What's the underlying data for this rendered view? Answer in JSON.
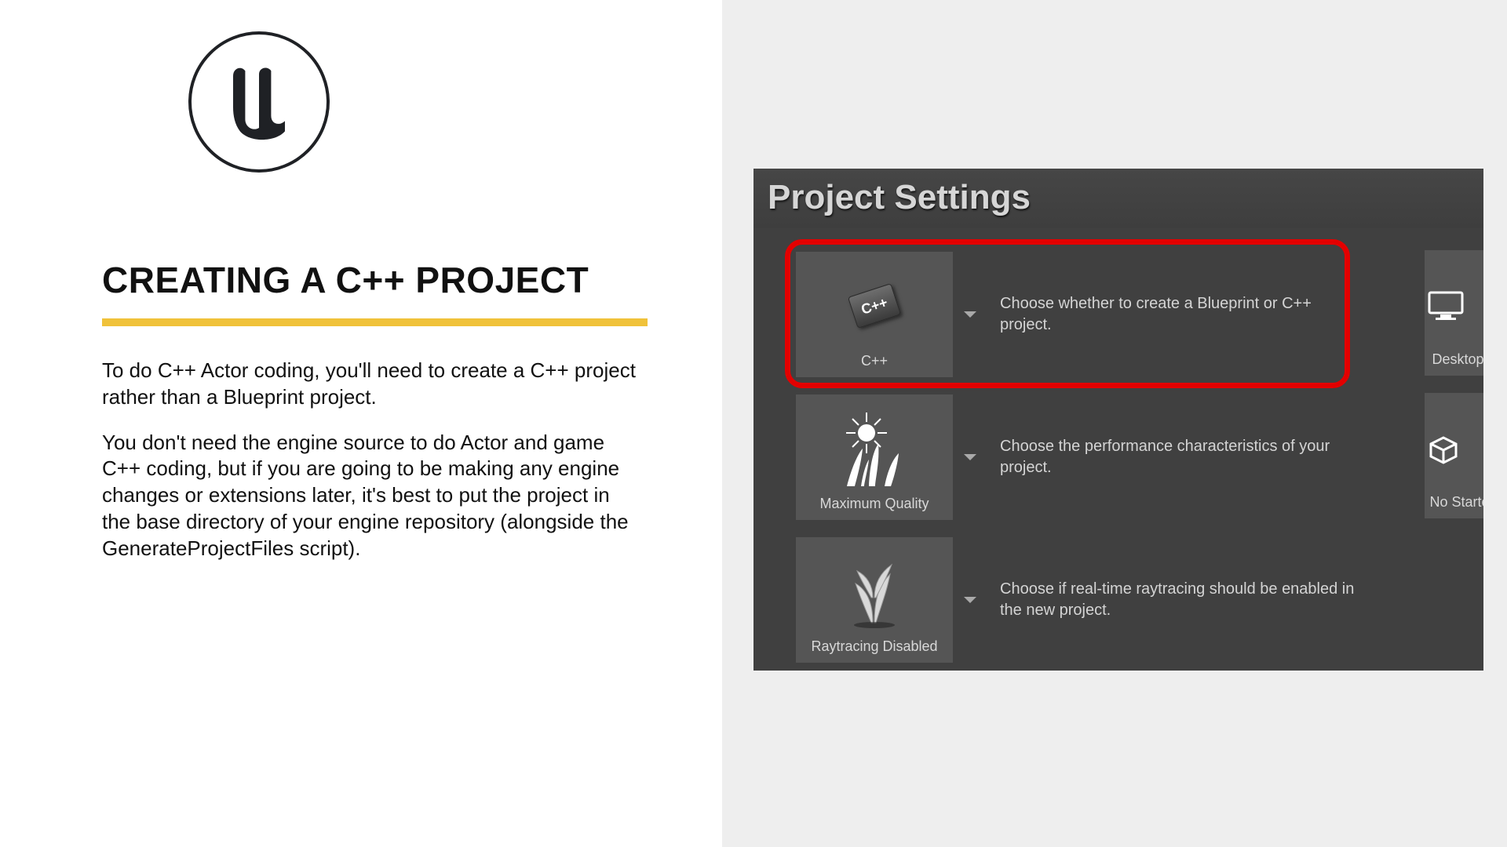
{
  "left": {
    "heading": "CREATING A C++ PROJECT",
    "para1": "To do C++ Actor coding, you'll need to create a C++ project rather than a Blueprint project.",
    "para2": "You don't need the engine source to do Actor and game C++ coding, but if you are going to be making any engine changes or extensions later, it's best to put the project in the base directory of your engine repository (alongside the GenerateProjectFiles script)."
  },
  "panel": {
    "title": "Project Settings",
    "rows": [
      {
        "label": "C++",
        "desc": "Choose whether to create a Blueprint or C++ project.",
        "highlighted": true
      },
      {
        "label": "Maximum Quality",
        "desc": "Choose the performance characteristics of your project.",
        "highlighted": false
      },
      {
        "label": "Raytracing Disabled",
        "desc": "Choose if real-time raytracing should be enabled in the new project.",
        "highlighted": false
      }
    ],
    "side": [
      {
        "label": "Desktop /"
      },
      {
        "label": "No Starter"
      }
    ],
    "cpp_badge": "C++"
  }
}
